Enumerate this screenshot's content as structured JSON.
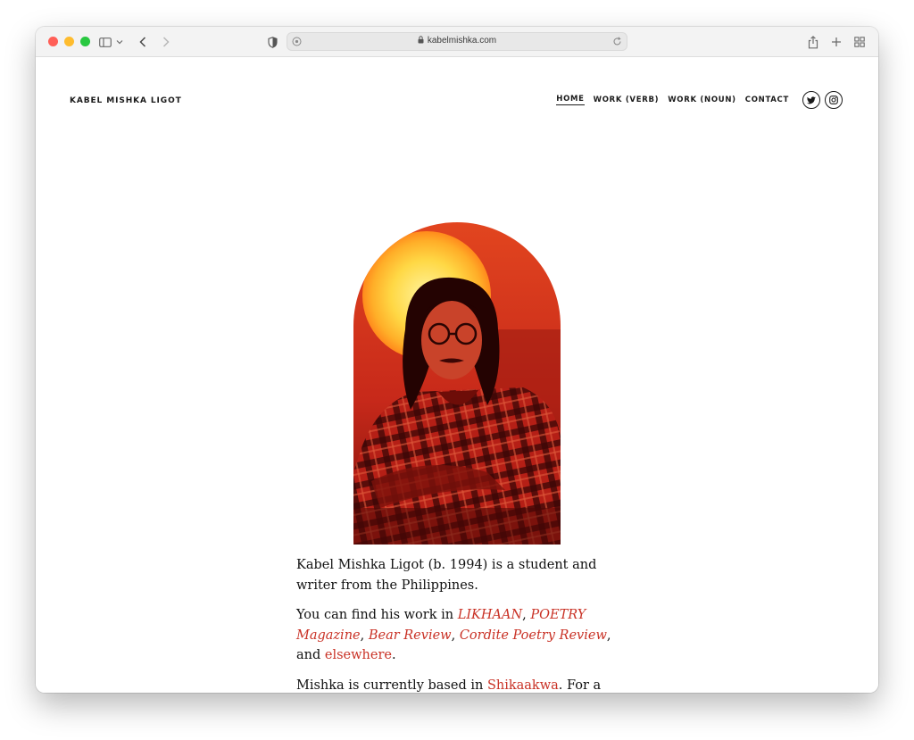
{
  "browser": {
    "url": "kabelmishka.com",
    "colors": {
      "close": "#ff5f57",
      "minimize": "#febc2e",
      "zoom": "#28c840"
    }
  },
  "site": {
    "title": "KABEL MISHKA LIGOT"
  },
  "nav": {
    "items": [
      {
        "label": "HOME"
      },
      {
        "label": "WORK (VERB)"
      },
      {
        "label": "WORK (NOUN)"
      },
      {
        "label": "CONTACT"
      }
    ],
    "social": [
      "twitter-icon",
      "instagram-icon"
    ]
  },
  "accent_color": "#c93226",
  "bio": {
    "p1": "Kabel Mishka Ligot (b. 1994) is a student and writer from the Philippines.",
    "p2_prefix": "You can find his work in ",
    "links": {
      "likhaan": "LIKHAAN",
      "poetry": "POETRY Magazine",
      "bear": "Bear Review",
      "cordite": "Cordite Poetry Review",
      "elsewhere": "elsewhere",
      "shikaakwa": "Shikaakwa"
    },
    "sep1": ", ",
    "sep2": ", ",
    "sep3": ", ",
    "and": ", and ",
    "period": ".",
    "p3_prefix": "Mishka is currently based in ",
    "p3_suffix": ". For a half-"
  }
}
